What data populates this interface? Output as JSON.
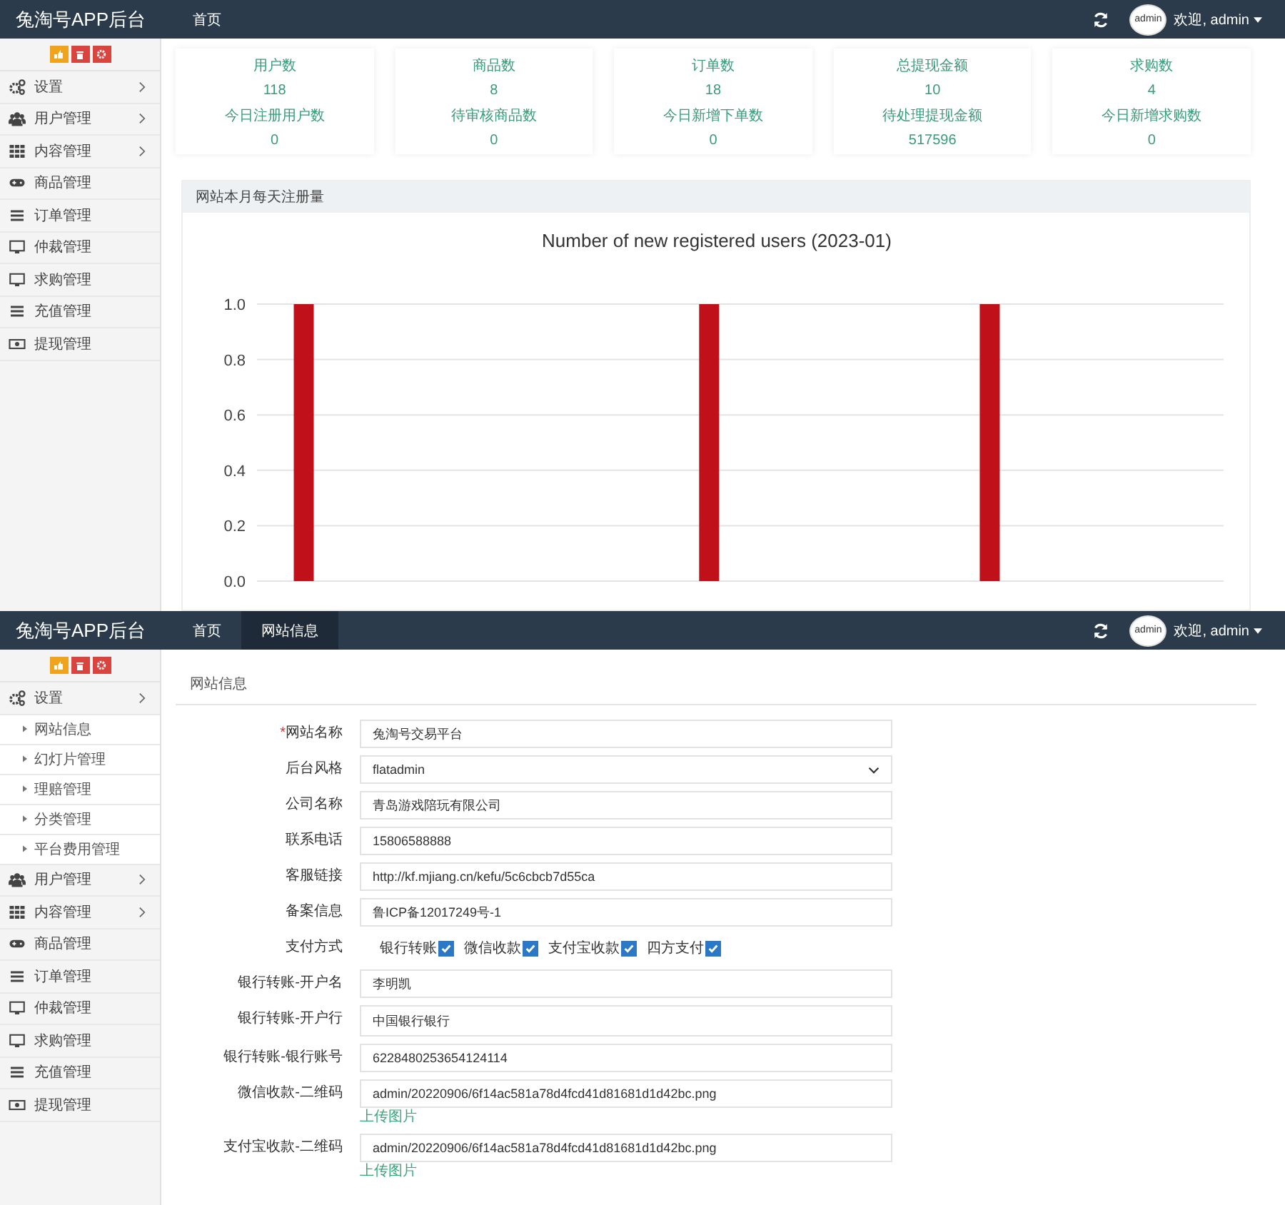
{
  "dashboard_screen": {
    "header": {
      "title": "兔淘号APP后台",
      "tabs": [
        {
          "label": "首页",
          "selected": false
        }
      ],
      "avatar_alt": "admin",
      "user_label": "欢迎, admin"
    },
    "sidebar": {
      "items": [
        {
          "label": "设置",
          "expandable": true
        },
        {
          "label": "用户管理",
          "expandable": true
        },
        {
          "label": "内容管理",
          "expandable": true
        },
        {
          "label": "商品管理",
          "expandable": false
        },
        {
          "label": "订单管理",
          "expandable": false
        },
        {
          "label": "仲裁管理",
          "expandable": false
        },
        {
          "label": "求购管理",
          "expandable": false
        },
        {
          "label": "充值管理",
          "expandable": false
        },
        {
          "label": "提现管理",
          "expandable": false
        }
      ]
    },
    "stats": [
      {
        "label": "用户数",
        "value": "118",
        "sub_label": "今日注册用户数",
        "sub_value": "0"
      },
      {
        "label": "商品数",
        "value": "8",
        "sub_label": "待审核商品数",
        "sub_value": "0"
      },
      {
        "label": "订单数",
        "value": "18",
        "sub_label": "今日新增下单数",
        "sub_value": "0"
      },
      {
        "label": "总提现金额",
        "value": "10",
        "sub_label": "待处理提现金额",
        "sub_value": "517596"
      },
      {
        "label": "求购数",
        "value": "4",
        "sub_label": "今日新增求购数",
        "sub_value": "0"
      }
    ],
    "chart_panel": {
      "title": "网站本月每天注册量",
      "chart_data": {
        "type": "bar",
        "title": "Number of new registered users (2023-01)",
        "grid": true,
        "ylim": [
          0,
          1
        ],
        "series": [
          {
            "color": "#c0101a",
            "values": [
              null,
              1,
              null,
              null,
              null,
              null,
              null,
              null,
              null,
              null,
              null,
              null,
              null,
              null,
              1,
              null,
              null,
              null,
              null,
              null,
              null,
              null,
              null,
              1,
              null,
              null,
              null,
              null,
              null,
              null,
              null
            ]
          }
        ],
        "yticks": [
          {
            "value": 0,
            "label": "0.0"
          },
          {
            "value": 0.2,
            "label": "0.2"
          },
          {
            "value": 0.4,
            "label": "0.4"
          },
          {
            "value": 0.6,
            "label": "0.6"
          },
          {
            "value": 0.8,
            "label": "0.8"
          },
          {
            "value": 1,
            "label": "1.0"
          }
        ]
      }
    }
  },
  "settings_screen": {
    "header": {
      "title": "兔淘号APP后台",
      "tabs": [
        {
          "label": "首页",
          "selected": false
        },
        {
          "label": "网站信息",
          "selected": true
        }
      ],
      "avatar_alt": "admin",
      "user_label": "欢迎, admin"
    },
    "sidebar": {
      "items": [
        {
          "label": "设置",
          "expandable": true,
          "children": [
            {
              "label": "网站信息"
            },
            {
              "label": "幻灯片管理"
            },
            {
              "label": "理赔管理"
            },
            {
              "label": "分类管理"
            },
            {
              "label": "平台费用管理"
            }
          ]
        },
        {
          "label": "用户管理",
          "expandable": true
        },
        {
          "label": "内容管理",
          "expandable": true
        },
        {
          "label": "商品管理",
          "expandable": false
        },
        {
          "label": "订单管理",
          "expandable": false
        },
        {
          "label": "仲裁管理",
          "expandable": false
        },
        {
          "label": "求购管理",
          "expandable": false
        },
        {
          "label": "充值管理",
          "expandable": false
        },
        {
          "label": "提现管理",
          "expandable": false
        }
      ]
    },
    "page_tab": "网站信息",
    "form": [
      {
        "kind": "text",
        "label": "网站名称",
        "required_mark": "*",
        "value": "兔淘号交易平台"
      },
      {
        "kind": "select",
        "label": "后台风格",
        "value": "flatadmin"
      },
      {
        "kind": "text",
        "label": "公司名称",
        "value": "青岛游戏陪玩有限公司"
      },
      {
        "kind": "text",
        "label": "联系电话",
        "value": "15806588888"
      },
      {
        "kind": "text",
        "label": "客服链接",
        "value": "http://kf.mjiang.cn/kefu/5c6cbcb7d55ca"
      },
      {
        "kind": "text",
        "label": "备案信息",
        "value": "鲁ICP备12017249号-1"
      },
      {
        "kind": "checkboxes",
        "label": "支付方式",
        "options": [
          {
            "label": "银行转账",
            "checked": true
          },
          {
            "label": "微信收款",
            "checked": true
          },
          {
            "label": "支付宝收款",
            "checked": true
          },
          {
            "label": "四方支付",
            "checked": true
          }
        ]
      },
      {
        "kind": "text",
        "label": "银行转账-开户名",
        "value": "李明凯"
      },
      {
        "kind": "textarea",
        "label": "银行转账-开户行",
        "value": "中国银行银行"
      },
      {
        "kind": "text",
        "label": "银行转账-银行账号",
        "value": "6228480253654124114"
      },
      {
        "kind": "upload",
        "label": "微信收款-二维码",
        "value": "admin/20220906/6f14ac581a78d4fcd41d81681d1d42bc.png",
        "link": "上传图片"
      },
      {
        "kind": "upload",
        "label": "支付宝收款-二维码",
        "value": "admin/20220906/6f14ac581a78d4fcd41d81681d1d42bc.png",
        "link": "上传图片"
      }
    ]
  }
}
